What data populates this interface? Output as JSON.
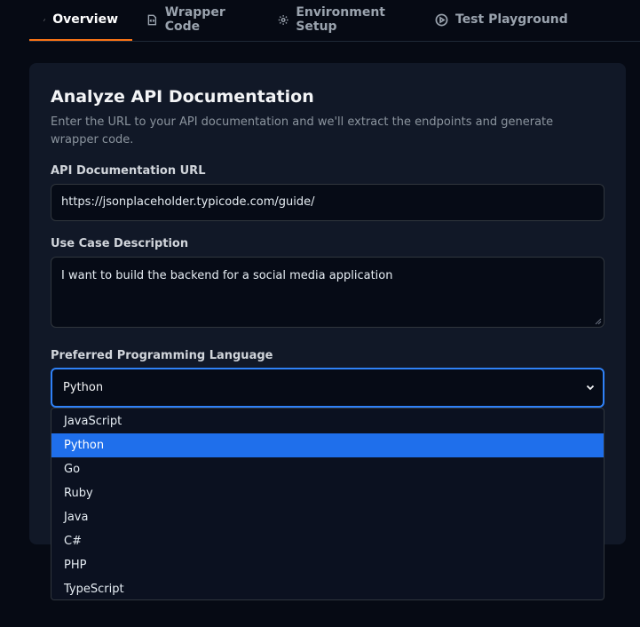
{
  "tabs": [
    {
      "label": "Overview",
      "icon": "expand-icon",
      "active": true
    },
    {
      "label": "Wrapper Code",
      "icon": "code-file-icon",
      "active": false
    },
    {
      "label": "Environment Setup",
      "icon": "gear-icon",
      "active": false
    },
    {
      "label": "Test Playground",
      "icon": "play-circle-icon",
      "active": false
    }
  ],
  "card": {
    "title": "Analyze API Documentation",
    "description": "Enter the URL to your API documentation and we'll extract the endpoints and generate wrapper code."
  },
  "form": {
    "url_label": "API Documentation URL",
    "url_value": "https://jsonplaceholder.typicode.com/guide/",
    "usecase_label": "Use Case Description",
    "usecase_value": "I want to build the backend for a social media application",
    "language_label": "Preferred Programming Language",
    "language_value": "Python",
    "language_options": [
      "JavaScript",
      "Python",
      "Go",
      "Ruby",
      "Java",
      "C#",
      "PHP",
      "TypeScript"
    ]
  },
  "colors": {
    "accent": "#f97316",
    "focus": "#2f81f7",
    "selected_option": "#1f6feb"
  }
}
